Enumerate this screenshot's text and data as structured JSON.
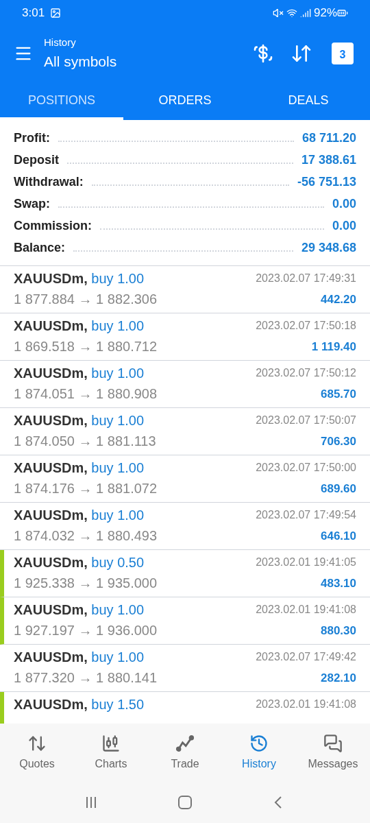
{
  "status_bar": {
    "time": "3:01",
    "battery": "92%"
  },
  "header": {
    "subtitle": "History",
    "title": "All symbols",
    "calendar_day": "3"
  },
  "tabs": [
    {
      "label": "POSITIONS",
      "selected": true
    },
    {
      "label": "ORDERS",
      "selected": false
    },
    {
      "label": "DEALS",
      "selected": false
    }
  ],
  "summary": [
    {
      "label": "Profit:",
      "value": "68 711.20"
    },
    {
      "label": "Deposit",
      "value": "17 388.61"
    },
    {
      "label": "Withdrawal:",
      "value": "-56 751.13"
    },
    {
      "label": "Swap:",
      "value": "0.00"
    },
    {
      "label": "Commission:",
      "value": "0.00"
    },
    {
      "label": "Balance:",
      "value": "29 348.68"
    }
  ],
  "positions": [
    {
      "symbol": "XAUUSDm,",
      "side": "buy 1.00",
      "prices": "1 877.884 → 1 882.306",
      "time": "2023.02.07 17:49:31",
      "profit": "442.20",
      "marked": false
    },
    {
      "symbol": "XAUUSDm,",
      "side": "buy 1.00",
      "prices": "1 869.518 → 1 880.712",
      "time": "2023.02.07 17:50:18",
      "profit": "1 119.40",
      "marked": false
    },
    {
      "symbol": "XAUUSDm,",
      "side": "buy 1.00",
      "prices": "1 874.051 → 1 880.908",
      "time": "2023.02.07 17:50:12",
      "profit": "685.70",
      "marked": false
    },
    {
      "symbol": "XAUUSDm,",
      "side": "buy 1.00",
      "prices": "1 874.050 → 1 881.113",
      "time": "2023.02.07 17:50:07",
      "profit": "706.30",
      "marked": false
    },
    {
      "symbol": "XAUUSDm,",
      "side": "buy 1.00",
      "prices": "1 874.176 → 1 881.072",
      "time": "2023.02.07 17:50:00",
      "profit": "689.60",
      "marked": false
    },
    {
      "symbol": "XAUUSDm,",
      "side": "buy 1.00",
      "prices": "1 874.032 → 1 880.493",
      "time": "2023.02.07 17:49:54",
      "profit": "646.10",
      "marked": false
    },
    {
      "symbol": "XAUUSDm,",
      "side": "buy 0.50",
      "prices": "1 925.338 → 1 935.000",
      "time": "2023.02.01 19:41:05",
      "profit": "483.10",
      "marked": true
    },
    {
      "symbol": "XAUUSDm,",
      "side": "buy 1.00",
      "prices": "1 927.197 → 1 936.000",
      "time": "2023.02.01 19:41:08",
      "profit": "880.30",
      "marked": true
    },
    {
      "symbol": "XAUUSDm,",
      "side": "buy 1.00",
      "prices": "1 877.320 → 1 880.141",
      "time": "2023.02.07 17:49:42",
      "profit": "282.10",
      "marked": false
    },
    {
      "symbol": "XAUUSDm,",
      "side": "buy 1.50",
      "time": "2023.02.01 19:41:08",
      "marked": true
    }
  ],
  "nav": [
    {
      "label": "Quotes",
      "kind": "quotes",
      "selected": false
    },
    {
      "label": "Charts",
      "kind": "charts",
      "selected": false
    },
    {
      "label": "Trade",
      "kind": "trade",
      "selected": false
    },
    {
      "label": "History",
      "kind": "history",
      "selected": true
    },
    {
      "label": "Messages",
      "kind": "messages",
      "selected": false
    }
  ]
}
